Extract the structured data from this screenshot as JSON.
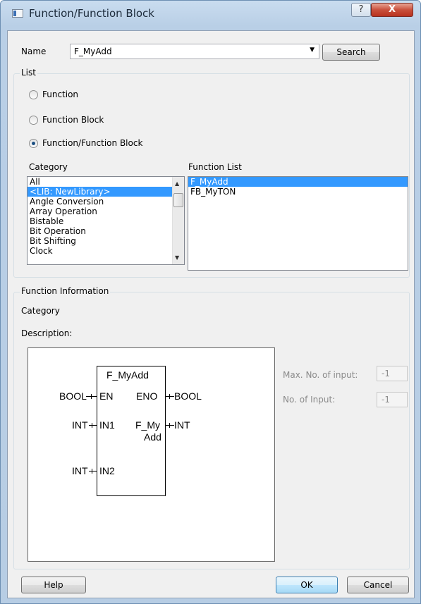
{
  "window": {
    "title": "Function/Function Block",
    "help_glyph": "?",
    "close_glyph": "X"
  },
  "name_field": {
    "label": "Name",
    "value": "F_MyAdd",
    "arrow": "▼"
  },
  "search_button": "Search",
  "list_group": {
    "title": "List",
    "radios": [
      {
        "label": "Function",
        "checked": false
      },
      {
        "label": "Function Block",
        "checked": false
      },
      {
        "label": "Function/Function Block",
        "checked": true
      }
    ]
  },
  "category": {
    "label": "Category",
    "items": [
      "All",
      "<LIB: NewLibrary>",
      "Angle Conversion",
      "Array Operation",
      "Bistable",
      "Bit Operation",
      "Bit Shifting",
      "Clock"
    ],
    "selected_index": 1
  },
  "function_list": {
    "label": "Function List",
    "items": [
      "F_MyAdd",
      "FB_MyTON"
    ],
    "selected_index": 0
  },
  "function_info": {
    "title": "Function Information",
    "category_label": "Category",
    "description_label": "Description:",
    "max_inputs_label": "Max. No. of input:",
    "max_inputs_value": "-1",
    "num_inputs_label": "No. of Input:",
    "num_inputs_value": "-1"
  },
  "diagram": {
    "block_name": "F_MyAdd",
    "en_type": "BOOL",
    "en_label": "EN",
    "eno_label": "ENO",
    "eno_type": "BOOL",
    "in1_type": "INT",
    "in1_label": "IN1",
    "out_label_1": "F_My",
    "out_label_2": "Add",
    "out_type": "INT",
    "in2_type": "INT",
    "in2_label": "IN2"
  },
  "footer": {
    "help_label": "Help",
    "ok_label": "OK",
    "cancel_label": "Cancel"
  }
}
